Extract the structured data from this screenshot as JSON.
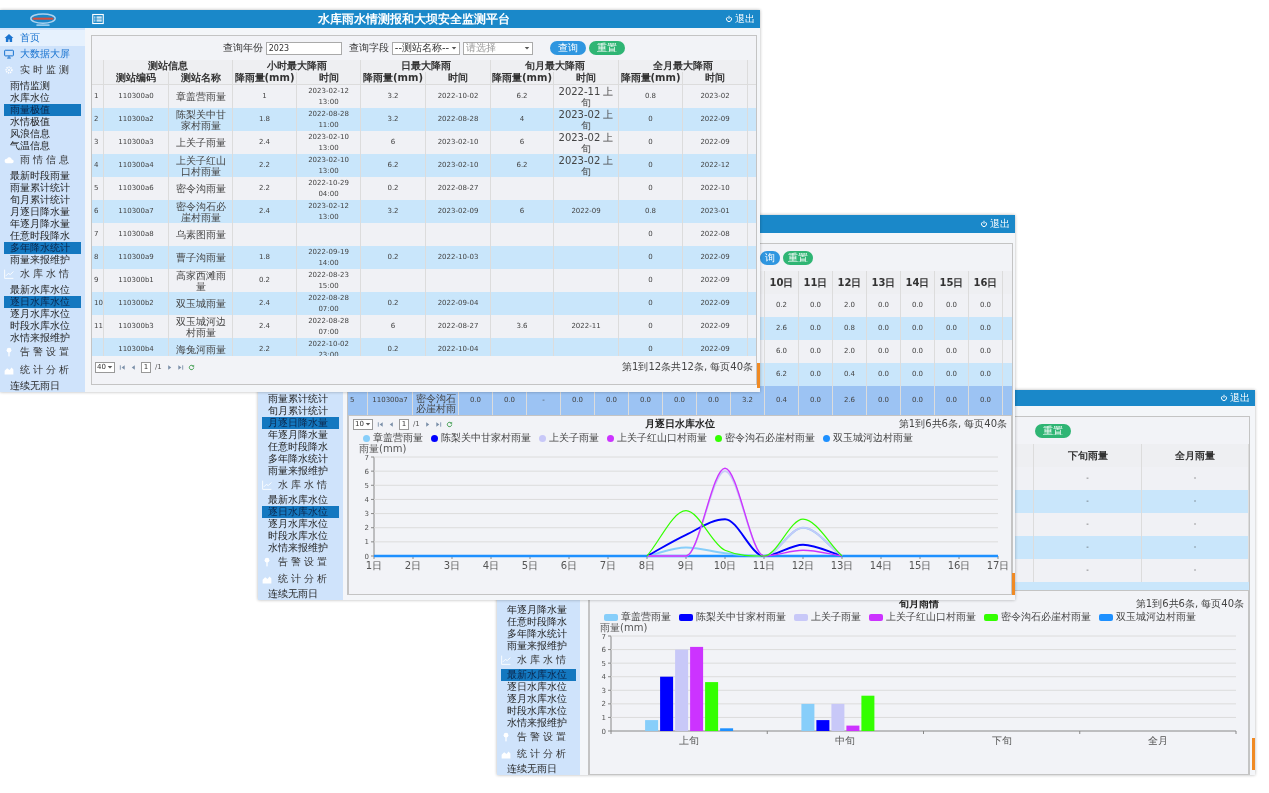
{
  "front_window": {
    "title": "水库雨水情测报和大坝安全监测平台",
    "logout": "退出",
    "sidebar": [
      {
        "kind": "home",
        "label": "首页",
        "selected": false
      },
      {
        "kind": "link",
        "label": "大数据大屏",
        "selected": false
      },
      {
        "kind": "group",
        "label": "实时监测",
        "selected": false
      },
      {
        "kind": "item",
        "label": "雨情监测",
        "selected": false
      },
      {
        "kind": "item",
        "label": "水库水位",
        "selected": false
      },
      {
        "kind": "item",
        "label": "雨量极值",
        "selected": true
      },
      {
        "kind": "item",
        "label": "水情极值",
        "selected": false
      },
      {
        "kind": "item",
        "label": "风浪信息",
        "selected": false
      },
      {
        "kind": "item",
        "label": "气温信息",
        "selected": false
      },
      {
        "kind": "group",
        "label": "雨情信息",
        "selected": false
      },
      {
        "kind": "item",
        "label": "最新时段雨量",
        "selected": false
      },
      {
        "kind": "item",
        "label": "雨量累计统计",
        "selected": false
      },
      {
        "kind": "item",
        "label": "旬月累计统计",
        "selected": false
      },
      {
        "kind": "item",
        "label": "月逐日降水量",
        "selected": false
      },
      {
        "kind": "item",
        "label": "年逐月降水量",
        "selected": false
      },
      {
        "kind": "item",
        "label": "任意时段降水",
        "selected": false
      },
      {
        "kind": "item",
        "label": "多年降水统计",
        "selected": true
      },
      {
        "kind": "item",
        "label": "雨量来报维护",
        "selected": false
      },
      {
        "kind": "group",
        "label": "水库水情",
        "selected": false
      },
      {
        "kind": "item",
        "label": "最新水库水位",
        "selected": false
      },
      {
        "kind": "item",
        "label": "逐日水库水位",
        "selected": true
      },
      {
        "kind": "item",
        "label": "逐月水库水位",
        "selected": false
      },
      {
        "kind": "item",
        "label": "时段水库水位",
        "selected": false
      },
      {
        "kind": "item",
        "label": "水情来报维护",
        "selected": false
      },
      {
        "kind": "group",
        "label": "告警设置",
        "selected": false
      },
      {
        "kind": "group",
        "label": "统计分析",
        "selected": false
      },
      {
        "kind": "item",
        "label": "连续无雨日",
        "selected": false
      }
    ],
    "query": {
      "year": {
        "label": "查询年份",
        "value": "2023"
      },
      "field": {
        "label": "查询字段",
        "value": "--测站名称--"
      },
      "station": {
        "placeholder": "请选择"
      },
      "buttons": [
        {
          "kind": "search",
          "label": "查询"
        },
        {
          "kind": "reset",
          "label": "重置"
        }
      ]
    },
    "table": {
      "groups": [
        {
          "label": "测站信息",
          "columns": [
            "测站编码",
            "测站名称"
          ]
        },
        {
          "label": "小时最大降雨",
          "columns": [
            "降雨量(mm)",
            "时间"
          ]
        },
        {
          "label": "日最大降雨",
          "columns": [
            "降雨量(mm)",
            "时间"
          ]
        },
        {
          "label": "旬月最大降雨",
          "columns": [
            "降雨量(mm)",
            "时间"
          ]
        },
        {
          "label": "全月最大降雨",
          "columns": [
            "降雨量(mm)",
            "时间"
          ]
        }
      ],
      "rows": [
        {
          "index": "1",
          "cells": [
            "110300a0",
            "章盖营雨量",
            "1",
            "2023-02-12 13:00",
            "3.2",
            "2022-10-02",
            "6.2",
            "2022-11 上旬",
            "0.8",
            "2023-02"
          ]
        },
        {
          "index": "2",
          "cells": [
            "110300a2",
            "陈梨关中甘家村雨量",
            "1.8",
            "2022-08-28 11:00",
            "3.2",
            "2022-08-28",
            "4",
            "2023-02 上旬",
            "0",
            "2022-09"
          ]
        },
        {
          "index": "3",
          "cells": [
            "110300a3",
            "上关子雨量",
            "2.4",
            "2023-02-10 13:00",
            "6",
            "2023-02-10",
            "6",
            "2023-02 上旬",
            "0",
            "2022-09"
          ]
        },
        {
          "index": "4",
          "cells": [
            "110300a4",
            "上关子红山口村雨量",
            "2.2",
            "2023-02-10 13:00",
            "6.2",
            "2023-02-10",
            "6.2",
            "2023-02 上旬",
            "0",
            "2022-12"
          ]
        },
        {
          "index": "5",
          "cells": [
            "110300a6",
            "密令沟雨量",
            "2.2",
            "2022-10-29 04:00",
            "0.2",
            "2022-08-27",
            null,
            null,
            "0",
            "2022-10"
          ]
        },
        {
          "index": "6",
          "cells": [
            "110300a7",
            "密令沟石必崖村雨量",
            "2.4",
            "2023-02-12 13:00",
            "3.2",
            "2023-02-09",
            "6",
            "2022-09",
            "0.8",
            "2023-01"
          ]
        },
        {
          "index": "7",
          "cells": [
            "110300a8",
            "乌素图雨量",
            null,
            null,
            null,
            null,
            null,
            null,
            "0",
            "2022-08"
          ]
        },
        {
          "index": "8",
          "cells": [
            "110300a9",
            "曹子沟雨量",
            "1.8",
            "2022-09-19 14:00",
            "0.2",
            "2022-10-03",
            null,
            null,
            "0",
            "2022-09"
          ]
        },
        {
          "index": "9",
          "cells": [
            "110300b1",
            "高家西滩雨量",
            "0.2",
            "2022-08-23 15:00",
            null,
            null,
            null,
            null,
            "0",
            "2022-09"
          ]
        },
        {
          "index": "10",
          "cells": [
            "110300b2",
            "双玉城雨量",
            "2.4",
            "2022-08-28 07:00",
            "0.2",
            "2022-09-04",
            null,
            null,
            "0",
            "2022-09"
          ]
        },
        {
          "index": "11",
          "cells": [
            "110300b3",
            "双玉城河边村雨量",
            "2.4",
            "2022-08-28 07:00",
            "6",
            "2022-08-27",
            "3.6",
            "2022-11",
            "0",
            "2022-09"
          ]
        },
        {
          "cells": [
            "110300b4",
            "海兔河雨量",
            "2.2",
            "2022-10-02 23:00",
            "0.2",
            "2022-10-04",
            null,
            null,
            "0",
            "2022-09"
          ]
        }
      ]
    },
    "pager": {
      "page_size": "40",
      "page": "1",
      "pages": "/1",
      "info": "第1到12条共12条, 每页40条"
    }
  },
  "middle_window": {
    "logout": "退出",
    "sidebar": [
      {
        "kind": "item",
        "label": "雨量累计统计",
        "selected": false
      },
      {
        "kind": "item",
        "label": "旬月累计统计",
        "selected": false
      },
      {
        "kind": "item",
        "label": "月逐日降水量",
        "selected": true
      },
      {
        "kind": "item",
        "label": "年逐月降水量",
        "selected": false
      },
      {
        "kind": "item",
        "label": "任意时段降水",
        "selected": false
      },
      {
        "kind": "item",
        "label": "多年降水统计",
        "selected": false
      },
      {
        "kind": "item",
        "label": "雨量来报维护",
        "selected": false
      },
      {
        "kind": "group",
        "label": "水库水情",
        "selected": false
      },
      {
        "kind": "item",
        "label": "最新水库水位",
        "selected": false
      },
      {
        "kind": "item",
        "label": "逐日水库水位",
        "selected": true
      },
      {
        "kind": "item",
        "label": "逐月水库水位",
        "selected": false
      },
      {
        "kind": "item",
        "label": "时段水库水位",
        "selected": false
      },
      {
        "kind": "item",
        "label": "水情来报维护",
        "selected": false
      },
      {
        "kind": "group",
        "label": "告警设置",
        "selected": false
      },
      {
        "kind": "group",
        "label": "统计分析",
        "selected": false
      },
      {
        "kind": "item",
        "label": "连续无雨日",
        "selected": false
      }
    ],
    "buttons": [
      {
        "kind": "search",
        "label": "询"
      },
      {
        "kind": "reset",
        "label": "重置"
      }
    ],
    "table": {
      "columns": [
        null,
        null,
        null,
        null,
        null,
        null,
        null,
        null,
        null,
        null,
        null,
        null,
        "10日",
        "11日",
        "12日",
        "13日",
        "14日",
        "15日",
        "16日"
      ],
      "rows": [
        {
          "selected": false,
          "cells": [
            null,
            null,
            null,
            null,
            null,
            null,
            null,
            null,
            null,
            null,
            null,
            null,
            "0.2",
            "0.0",
            "2.0",
            "0.0",
            "0.0",
            "0.0",
            "0.0"
          ]
        },
        {
          "selected": false,
          "cells": [
            null,
            null,
            null,
            null,
            null,
            null,
            null,
            null,
            null,
            null,
            null,
            null,
            "2.6",
            "0.0",
            "0.8",
            "0.0",
            "0.0",
            "0.0",
            "0.0"
          ]
        },
        {
          "selected": false,
          "cells": [
            null,
            null,
            null,
            null,
            null,
            null,
            null,
            null,
            null,
            null,
            null,
            null,
            "6.0",
            "0.0",
            "2.0",
            "0.0",
            "0.0",
            "0.0",
            "0.0"
          ]
        },
        {
          "selected": false,
          "cells": [
            null,
            null,
            null,
            null,
            null,
            null,
            null,
            null,
            null,
            null,
            null,
            null,
            "6.2",
            "0.0",
            "0.4",
            "0.0",
            "0.0",
            "0.0",
            "0.0"
          ]
        },
        {
          "selected": true,
          "cells": [
            "5",
            "110300a7",
            "密令沟石必崖村雨",
            "0.0",
            "0.0",
            "-",
            "0.0",
            "0.0",
            "0.0",
            "0.0",
            "0.0",
            "3.2",
            "0.4",
            "0.0",
            "2.6",
            "0.0",
            "0.0",
            "0.0",
            "0.0"
          ]
        }
      ]
    },
    "chart_panel": {
      "pager": {
        "page_size": "10",
        "page": "1",
        "pages": "/1"
      },
      "info": "第1到6共6条, 每页40条",
      "chart_data": {
        "type": "line",
        "title": "月逐日水库水位",
        "ylabel": "雨量(mm)",
        "ylim": [
          0,
          7
        ],
        "yticks": [
          0,
          1,
          2,
          3,
          4,
          5,
          6,
          7
        ],
        "grid": true,
        "legend": true,
        "categories": [
          "1日",
          "2日",
          "3日",
          "4日",
          "5日",
          "6日",
          "7日",
          "8日",
          "9日",
          "10日",
          "11日",
          "12日",
          "13日",
          "14日",
          "15日",
          "16日",
          "17日"
        ],
        "series": [
          {
            "name": "章盖营雨量",
            "color": "#87cefa",
            "values": [
              null,
              null,
              null,
              null,
              null,
              null,
              null,
              0,
              0.6,
              0.2,
              0,
              2.0,
              0,
              null,
              null,
              null,
              null
            ]
          },
          {
            "name": "陈梨关中甘家村雨量",
            "color": "#0000ff",
            "values": [
              null,
              null,
              null,
              null,
              null,
              null,
              null,
              0,
              1.5,
              2.6,
              0,
              0.8,
              0,
              null,
              null,
              null,
              null
            ]
          },
          {
            "name": "上关子雨量",
            "color": "#c8c8f8",
            "values": [
              null,
              null,
              null,
              null,
              null,
              null,
              null,
              0,
              0,
              6.0,
              0,
              2.0,
              0,
              null,
              null,
              null,
              null
            ]
          },
          {
            "name": "上关子红山口村雨量",
            "color": "#cc33ff",
            "values": [
              null,
              null,
              null,
              null,
              null,
              null,
              null,
              0,
              0,
              6.2,
              0,
              0.4,
              0,
              null,
              null,
              null,
              null
            ]
          },
          {
            "name": "密令沟石必崖村雨量",
            "color": "#33ff00",
            "values": [
              null,
              null,
              null,
              null,
              null,
              null,
              null,
              0,
              3.2,
              0.4,
              0,
              2.6,
              0,
              null,
              null,
              null,
              null
            ]
          },
          {
            "name": "双玉城河边村雨量",
            "color": "#1e90ff",
            "values": [
              0,
              0,
              0,
              0,
              0,
              0,
              0,
              0,
              0,
              0,
              0,
              0,
              0,
              0,
              0,
              0,
              0
            ]
          }
        ]
      }
    }
  },
  "back_window": {
    "logout": "退出",
    "sidebar": [
      {
        "kind": "item",
        "label": "年逐月降水量",
        "selected": false
      },
      {
        "kind": "item",
        "label": "任意时段降水",
        "selected": false
      },
      {
        "kind": "item",
        "label": "多年降水统计",
        "selected": false
      },
      {
        "kind": "item",
        "label": "雨量来报维护",
        "selected": false
      },
      {
        "kind": "group",
        "label": "水库水情",
        "selected": false
      },
      {
        "kind": "item",
        "label": "最新水库水位",
        "selected": true
      },
      {
        "kind": "item",
        "label": "逐日水库水位",
        "selected": false
      },
      {
        "kind": "item",
        "label": "逐月水库水位",
        "selected": false
      },
      {
        "kind": "item",
        "label": "时段水库水位",
        "selected": false
      },
      {
        "kind": "item",
        "label": "水情来报维护",
        "selected": false
      },
      {
        "kind": "group",
        "label": "告警设置",
        "selected": false
      },
      {
        "kind": "group",
        "label": "统计分析",
        "selected": false
      },
      {
        "kind": "item",
        "label": "连续无雨日",
        "selected": false
      }
    ],
    "buttons": [
      {
        "kind": "reset",
        "label": "重置"
      }
    ],
    "table": {
      "columns": [
        null,
        "下旬雨量",
        "全月雨量"
      ],
      "rows": [
        {
          "selected": false,
          "cells": [
            null,
            "-",
            "-"
          ]
        },
        {
          "selected": false,
          "cells": [
            null,
            "-",
            "-"
          ]
        },
        {
          "selected": false,
          "cells": [
            null,
            "-",
            "-"
          ]
        },
        {
          "selected": false,
          "cells": [
            null,
            "-",
            "-"
          ]
        },
        {
          "selected": false,
          "cells": [
            null,
            "-",
            "-"
          ]
        }
      ]
    },
    "chart_panel": {
      "info": "第1到6共6条, 每页40条",
      "chart_data": {
        "type": "bar",
        "title": "旬月雨情",
        "ylabel": "雨量(mm)",
        "ylim": [
          0,
          7
        ],
        "yticks": [
          0,
          1,
          2,
          3,
          4,
          5,
          6,
          7
        ],
        "grid": true,
        "legend": true,
        "categories": [
          "上旬",
          "中旬",
          "下旬",
          "全月"
        ],
        "series": [
          {
            "name": "章盖营雨量",
            "color": "#87cefa",
            "values": [
              0.8,
              2,
              null,
              null
            ]
          },
          {
            "name": "陈梨关中甘家村雨量",
            "color": "#0000ff",
            "values": [
              4,
              0.8,
              null,
              null
            ]
          },
          {
            "name": "上关子雨量",
            "color": "#c8c8f8",
            "values": [
              6,
              2,
              null,
              null
            ]
          },
          {
            "name": "上关子红山口村雨量",
            "color": "#cc33ff",
            "values": [
              6.2,
              0.4,
              null,
              null
            ]
          },
          {
            "name": "密令沟石必崖村雨量",
            "color": "#33ff00",
            "values": [
              3.6,
              2.6,
              null,
              null
            ]
          },
          {
            "name": "双玉城河边村雨量",
            "color": "#1e90ff",
            "values": [
              0.2,
              null,
              null,
              null
            ]
          }
        ]
      }
    }
  }
}
